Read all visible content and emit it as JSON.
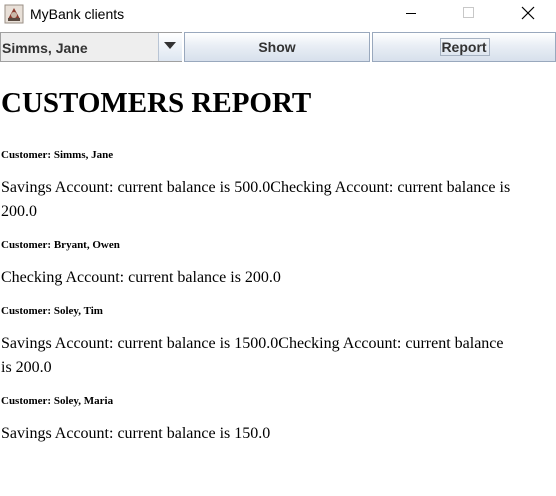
{
  "window": {
    "title": "MyBank clients",
    "icon": "bank-app-icon"
  },
  "toolbar": {
    "customer_select_value": "Simms, Jane",
    "show_label": "Show",
    "report_label": "Report"
  },
  "report": {
    "title": "CUSTOMERS REPORT",
    "customers": [
      {
        "heading": "Customer: Simms, Jane",
        "accounts": "Savings Account: current balance is 500.0Checking Account: current balance is 200.0"
      },
      {
        "heading": "Customer: Bryant, Owen",
        "accounts": "Checking Account: current balance is 200.0"
      },
      {
        "heading": "Customer: Soley, Tim",
        "accounts": "Savings Account: current balance is 1500.0Checking Account: current balance is 200.0"
      },
      {
        "heading": "Customer: Soley, Maria",
        "accounts": "Savings Account: current balance is 150.0"
      }
    ]
  }
}
